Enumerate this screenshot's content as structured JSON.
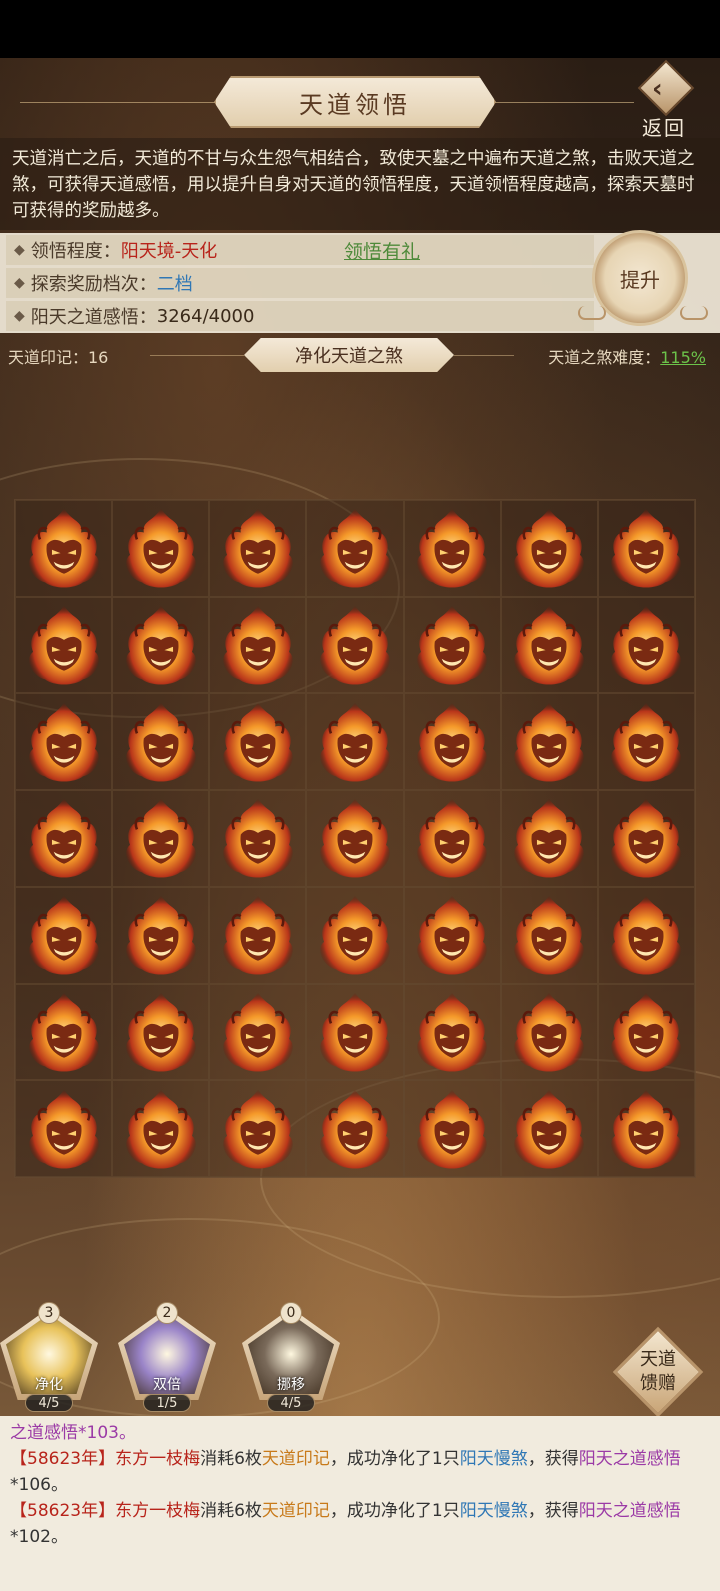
{
  "header": {
    "title": "天道领悟",
    "back_label": "返回"
  },
  "description": "天道消亡之后，天道的不甘与众生怨气相结合，致使天墓之中遍布天道之煞，击败天道之煞，可获得天道感悟，用以提升自身对天道的领悟程度，天道领悟程度越高，探索天墓时可获得的奖励越多。",
  "info": {
    "comprehension_label": "领悟程度：",
    "comprehension_value": "阳天境-天化",
    "gift_link": "领悟有礼",
    "reward_label": "探索奖励档次：",
    "reward_value": "二档",
    "insight_label": "阳天之道感悟：",
    "insight_value": "3264/4000",
    "upgrade_button": "提升"
  },
  "bar": {
    "mark_label": "天道印记：16",
    "purify_title": "净化天道之煞",
    "difficulty_label": "天道之煞难度：",
    "difficulty_value": "115%"
  },
  "grid": {
    "rows": 7,
    "cols": 7,
    "cell_icon": "flame-demon-icon"
  },
  "skills": [
    {
      "name": "净化",
      "count": "3",
      "uses": "4/5",
      "color": "#e8c25a"
    },
    {
      "name": "双倍",
      "count": "2",
      "uses": "1/5",
      "color": "#9a84c8"
    },
    {
      "name": "挪移",
      "count": "0",
      "uses": "4/5",
      "color": "#7a6a5a"
    }
  ],
  "gift_button": {
    "line1": "天道",
    "line2": "馈赠"
  },
  "log": {
    "line0": "之道感悟*103。",
    "entries": [
      {
        "year": "【58623年】",
        "player": "东方一枝梅",
        "t1": "消耗6枚",
        "item": "天道印记",
        "t2": "，成功净化了1只",
        "monster": "阳天慢煞",
        "t3": "，获得",
        "reward": "阳天之道感悟",
        "amount": "*106。"
      },
      {
        "year": "【58623年】",
        "player": "东方一枝梅",
        "t1": "消耗6枚",
        "item": "天道印记",
        "t2": "，成功净化了1只",
        "monster": "阳天慢煞",
        "t3": "，获得",
        "reward": "阳天之道感悟",
        "amount": "*102。"
      }
    ]
  }
}
